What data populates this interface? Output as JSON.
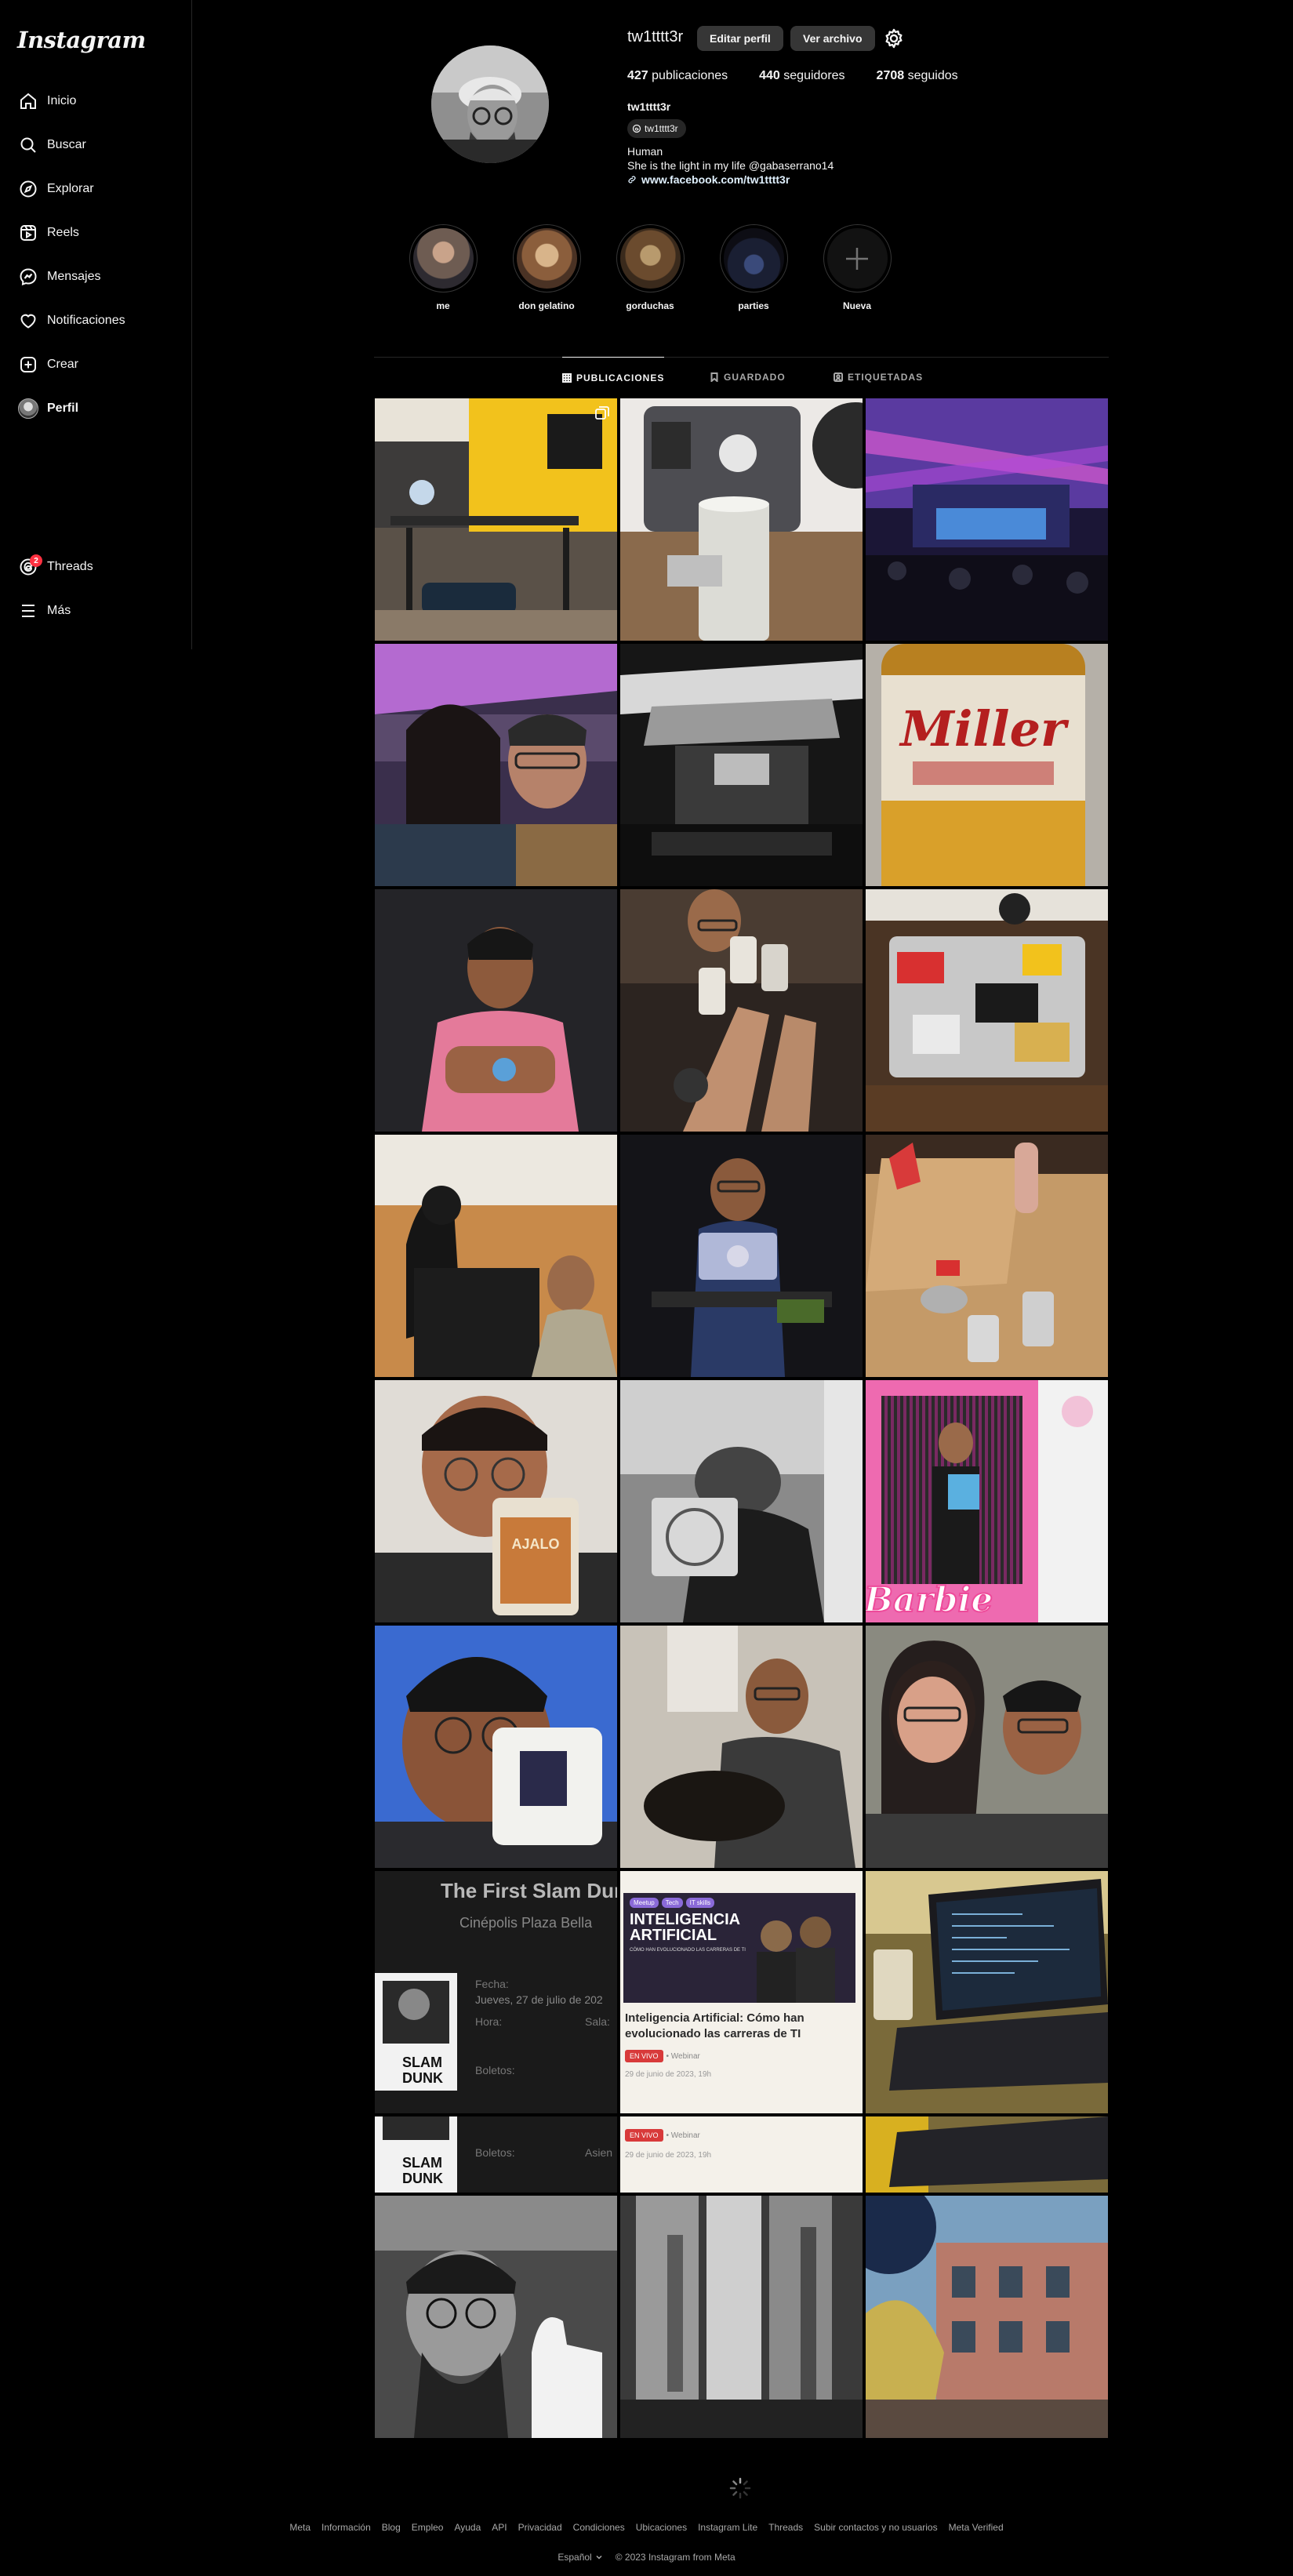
{
  "brand": {
    "logo": "Instagram"
  },
  "sidebar": {
    "items": [
      {
        "label": "Inicio",
        "icon": "home-icon"
      },
      {
        "label": "Buscar",
        "icon": "search-icon"
      },
      {
        "label": "Explorar",
        "icon": "compass-icon"
      },
      {
        "label": "Reels",
        "icon": "reels-icon"
      },
      {
        "label": "Mensajes",
        "icon": "messenger-icon"
      },
      {
        "label": "Notificaciones",
        "icon": "heart-icon"
      },
      {
        "label": "Crear",
        "icon": "plus-square-icon"
      },
      {
        "label": "Perfil",
        "icon": "avatar"
      }
    ],
    "bottom": [
      {
        "label": "Threads",
        "icon": "threads-icon",
        "badge": "2"
      },
      {
        "label": "Más",
        "icon": "menu-icon"
      }
    ]
  },
  "profile": {
    "username": "tw1tttt3r",
    "edit_label": "Editar perfil",
    "archive_label": "Ver archivo",
    "stats": {
      "posts": "427",
      "posts_label": "publicaciones",
      "followers": "440",
      "followers_label": "seguidores",
      "following": "2708",
      "following_label": "seguidos"
    },
    "full_name": "tw1tttt3r",
    "threads_handle": "tw1tttt3r",
    "bio_line1": "Human",
    "bio_line2": "She is the light in my life @gabaserrano14",
    "website": "www.facebook.com/tw1tttt3r"
  },
  "highlights": [
    {
      "label": "me"
    },
    {
      "label": "don gelatino"
    },
    {
      "label": "gorduchas"
    },
    {
      "label": "parties"
    },
    {
      "label": "Nueva"
    }
  ],
  "tabs": [
    {
      "label": "PUBLICACIONES",
      "active": true
    },
    {
      "label": "GUARDADO",
      "active": false
    },
    {
      "label": "ETIQUETADAS",
      "active": false
    }
  ],
  "posts": {
    "slam_title": "The First Slam Dun",
    "slam_venue": "Cinépolis Plaza Bella",
    "slam_fecha_label": "Fecha:",
    "slam_fecha": "Jueves, 27 de julio de 202",
    "slam_hora_label": "Hora:",
    "slam_sala_label": "Sala:",
    "slam_boletos_label": "Boletos:",
    "slam_asien_label": "Asien",
    "webinar_tags": [
      "Meetup",
      "Tech",
      "IT skills"
    ],
    "webinar_banner": "INTELIGENCIA ARTIFICIAL",
    "webinar_banner_sub": "CÓMO HAN EVOLUCIONADO LAS CARRERAS DE TI",
    "webinar_title": "Inteligencia Artificial: Cómo han evolucionado las carreras de TI",
    "webinar_live": "EN VIVO",
    "webinar_type": "• Webinar",
    "webinar_date": "29 de junio de 2023, 19h",
    "beer_label": "Miller",
    "mug_label": "AJALO",
    "barbie_label": "Barbie"
  },
  "footer": {
    "links": [
      "Meta",
      "Información",
      "Blog",
      "Empleo",
      "Ayuda",
      "API",
      "Privacidad",
      "Condiciones",
      "Ubicaciones",
      "Instagram Lite",
      "Threads",
      "Subir contactos y no usuarios",
      "Meta Verified"
    ],
    "language": "Español",
    "copyright": "© 2023 Instagram from Meta"
  },
  "colors": {
    "background": "#000000",
    "badge": "#ff3040",
    "button": "#363636",
    "divider": "#262626"
  }
}
